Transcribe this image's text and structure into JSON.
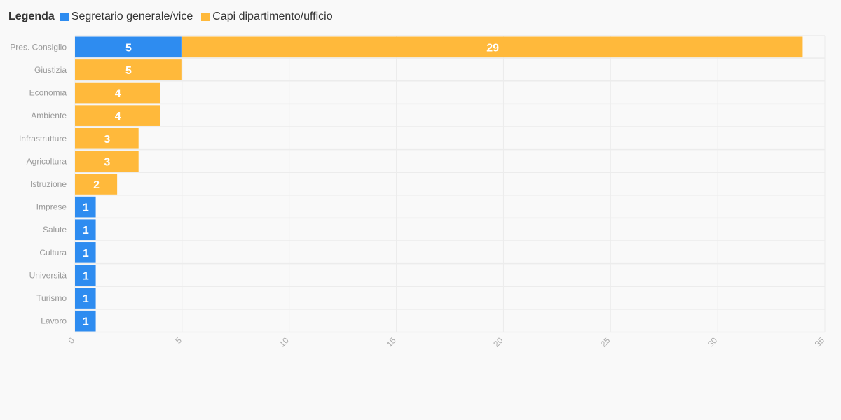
{
  "legend": {
    "title": "Legenda",
    "items": [
      {
        "label": "Segretario generale/vice",
        "color": "#2e8cf0"
      },
      {
        "label": "Capi dipartimento/ufficio",
        "color": "#ffb93b"
      }
    ]
  },
  "chart_data": {
    "type": "bar",
    "orientation": "horizontal",
    "stacked": true,
    "categories": [
      "Pres. Consiglio",
      "Giustizia",
      "Economia",
      "Ambiente",
      "Infrastrutture",
      "Agricoltura",
      "Istruzione",
      "Imprese",
      "Salute",
      "Cultura",
      "Università",
      "Turismo",
      "Lavoro"
    ],
    "series": [
      {
        "name": "Segretario generale/vice",
        "color": "#2e8cf0",
        "values": [
          5,
          0,
          0,
          0,
          0,
          0,
          0,
          1,
          1,
          1,
          1,
          1,
          1
        ]
      },
      {
        "name": "Capi dipartimento/ufficio",
        "color": "#ffb93b",
        "values": [
          29,
          5,
          4,
          4,
          3,
          3,
          2,
          0,
          0,
          0,
          0,
          0,
          0
        ]
      }
    ],
    "xlim": [
      0,
      35
    ],
    "xticks": [
      0,
      5,
      10,
      15,
      20,
      25,
      30,
      35
    ],
    "grid": true,
    "legend_position": "top-left",
    "data_labels": true
  }
}
